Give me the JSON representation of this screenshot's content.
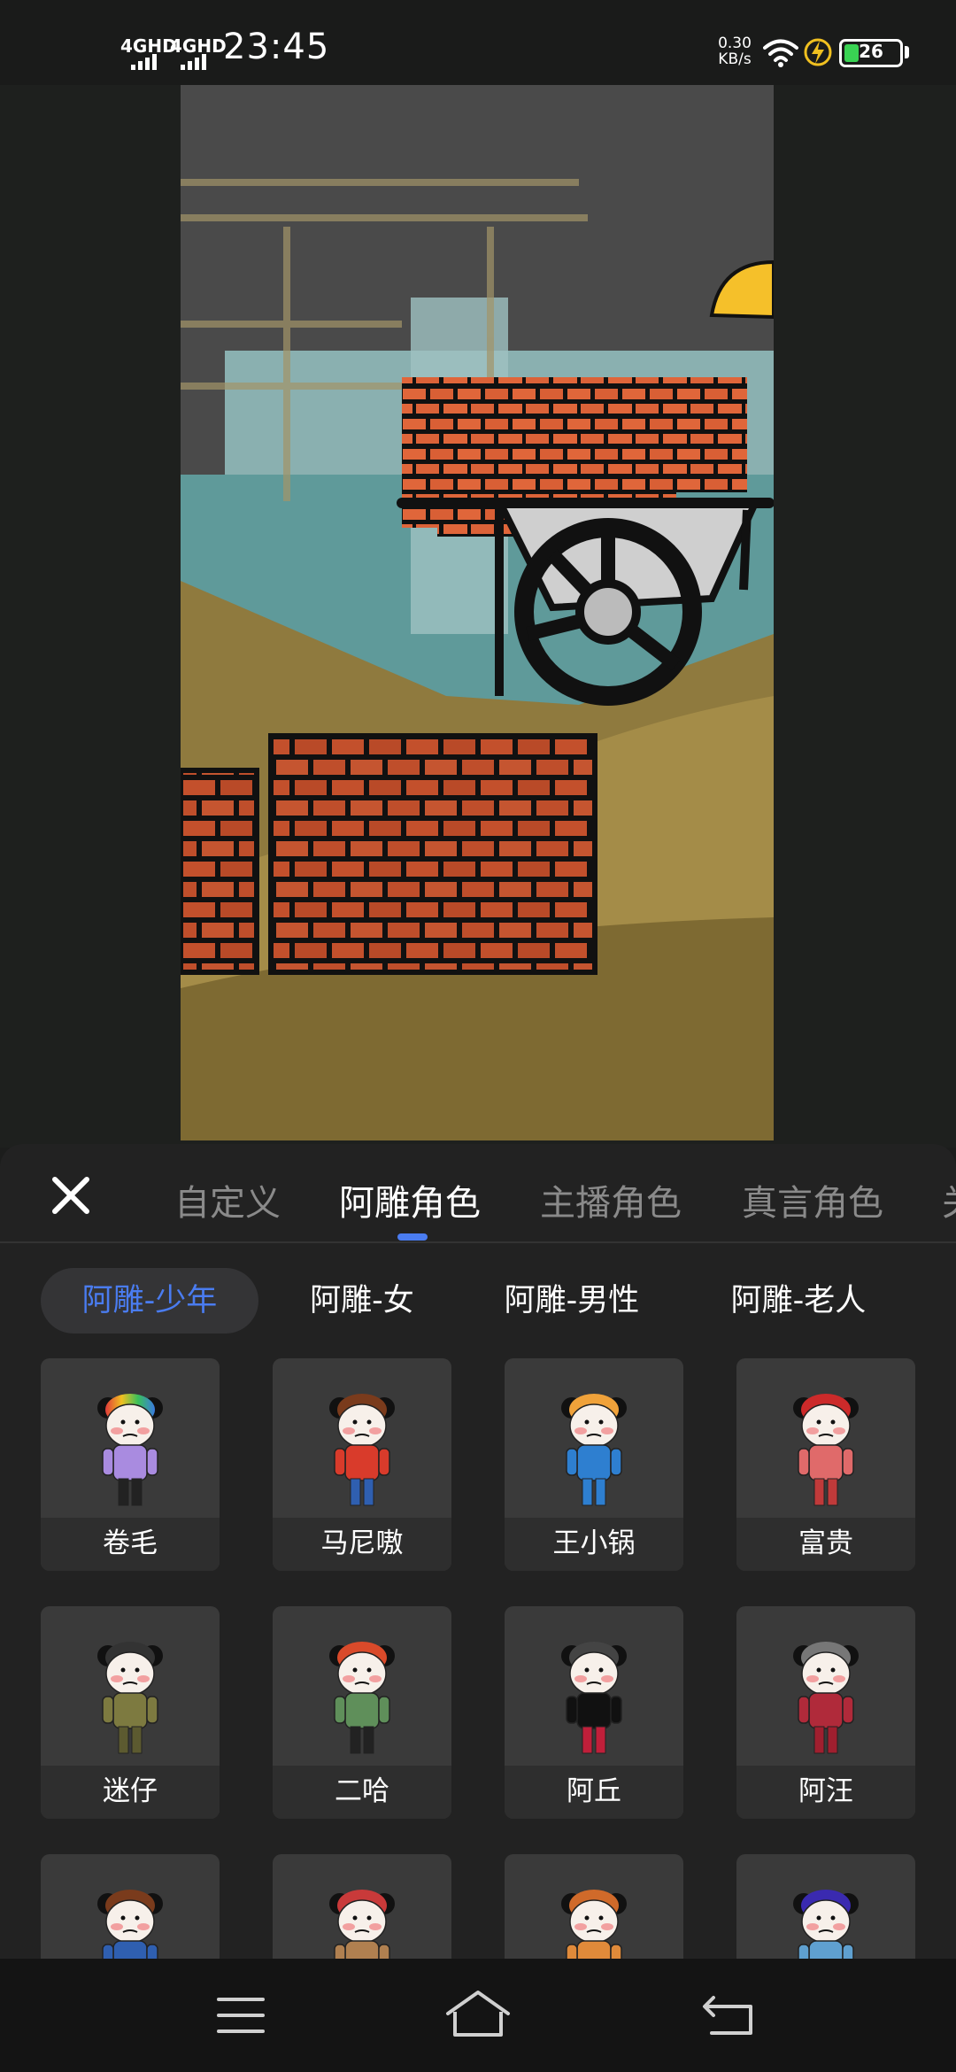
{
  "status_bar": {
    "time": "23:45",
    "signal_1": "4GHD",
    "signal_2": "4GHD",
    "net_speed_value": "0.30",
    "net_speed_unit": "KB/s",
    "battery_level": "26",
    "battery_fraction": 0.26,
    "icons": [
      "signal-icon",
      "wifi-icon",
      "charging-icon",
      "battery-icon"
    ]
  },
  "tabs": [
    {
      "label": "自定义",
      "active": false
    },
    {
      "label": "阿雕角色",
      "active": true
    },
    {
      "label": "主播角色",
      "active": false
    },
    {
      "label": "真言角色",
      "active": false
    },
    {
      "label": "关",
      "active": false
    }
  ],
  "subtabs": [
    {
      "label": "阿雕-少年",
      "active": true
    },
    {
      "label": "阿雕-女",
      "active": false
    },
    {
      "label": "阿雕-男性",
      "active": false
    },
    {
      "label": "阿雕-老人",
      "active": false
    }
  ],
  "characters": [
    {
      "name": "卷毛",
      "hair": "rainbow",
      "shirt": "#a98be0",
      "pants": "#222222"
    },
    {
      "name": "马尼嗷",
      "hair": "#7a3b1c",
      "shirt": "#d93b2b",
      "pants": "#2f5fb0"
    },
    {
      "name": "王小锅",
      "hair": "#f0a23a",
      "shirt": "#2e7fd0",
      "pants": "#2e7fd0"
    },
    {
      "name": "富贵",
      "hair": "#cc2a2a",
      "shirt": "#e06a6a",
      "pants": "#c03a3a"
    },
    {
      "name": "迷仔",
      "hair": "#333333",
      "shirt": "#7d7a40",
      "pants": "#5c5a30"
    },
    {
      "name": "二哈",
      "hair": "#d94a2a",
      "shirt": "#5f8f5a",
      "pants": "#222222"
    },
    {
      "name": "阿丘",
      "hair": "#444444",
      "shirt": "#111111",
      "pants": "#c01f3a"
    },
    {
      "name": "阿汪",
      "hair": "#777777",
      "shirt": "#b02a3a",
      "pants": "#a01f2f"
    },
    {
      "name": "",
      "hair": "#7a3b1c",
      "shirt": "#2f5fb0",
      "pants": "#2f5fb0"
    },
    {
      "name": "",
      "hair": "#c93a3a",
      "shirt": "#b08050",
      "pants": "#7a5030"
    },
    {
      "name": "",
      "hair": "#d06a2a",
      "shirt": "#e08a3a",
      "pants": "#c06a2a"
    },
    {
      "name": "",
      "hair": "#3a2ab0",
      "shirt": "#5fa0d0",
      "pants": "#3a70b0"
    }
  ],
  "nav": {
    "icons": [
      "menu-icon",
      "home-icon",
      "back-icon"
    ]
  }
}
